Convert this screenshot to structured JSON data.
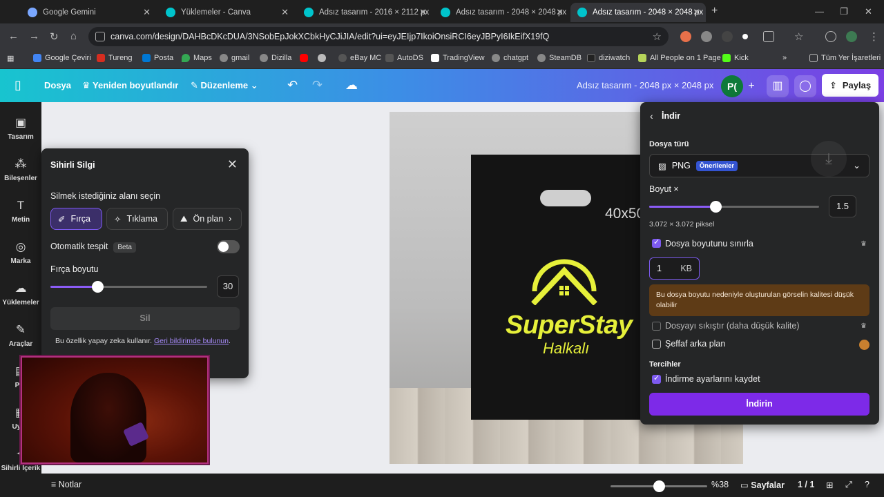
{
  "browser": {
    "tabs": [
      {
        "title": "Google Gemini",
        "color": "#7aa7ff"
      },
      {
        "title": "Yüklemeler - Canva",
        "color": "#00c4cc"
      },
      {
        "title": "Adsız tasarım - 2016 × 2112 px",
        "color": "#00c4cc"
      },
      {
        "title": "Adsız tasarım - 2048 × 2048 px",
        "color": "#00c4cc"
      },
      {
        "title": "Adsız tasarım - 2048 × 2048 px",
        "color": "#00c4cc"
      }
    ],
    "new_tab": "+",
    "url": "canva.com/design/DAHBcDKcDUA/3NSobEpJokXCbkHyCJiJIA/edit?ui=eyJEIjp7IkoiOnsiRCI6eyJBPyI6IkEifX19fQ",
    "bookmarks": [
      {
        "label": "Google Çeviri",
        "color": "#4285f4"
      },
      {
        "label": "Tureng",
        "color": "#d62d20"
      },
      {
        "label": "Posta",
        "color": "#0078d4"
      },
      {
        "label": "Maps",
        "color": "#34a853"
      },
      {
        "label": "gmail",
        "color": "#888888"
      },
      {
        "label": "Dizilla",
        "color": "#888888"
      },
      {
        "label": "eBay MC",
        "color": "#555555"
      },
      {
        "label": "AutoDS",
        "color": "#555555"
      },
      {
        "label": "TradingView",
        "color": "#ffffff"
      },
      {
        "label": "chatgpt",
        "color": "#888888"
      },
      {
        "label": "SteamDB",
        "color": "#888888"
      },
      {
        "label": "diziwatch",
        "color": "#222222"
      },
      {
        "label": "All People on 1 Page",
        "color": "#b6d45a"
      },
      {
        "label": "Kick",
        "color": "#53fc18"
      }
    ],
    "all_bookmarks": "Tüm Yer İşaretleri"
  },
  "canva": {
    "menu": {
      "file": "Dosya",
      "resize": "Yeniden boyutlandır",
      "edit": "Düzenleme"
    },
    "design_title": "Adsız tasarım - 2048 px × 2048 px",
    "avatar": "P(",
    "share": "Paylaş"
  },
  "rail": [
    {
      "label": "Tasarım",
      "icon": "layout-icon"
    },
    {
      "label": "Bileşenler",
      "icon": "elements-icon"
    },
    {
      "label": "Metin",
      "icon": "text-icon"
    },
    {
      "label": "Marka",
      "icon": "brand-icon"
    },
    {
      "label": "Yüklemeler",
      "icon": "upload-icon"
    },
    {
      "label": "Araçlar",
      "icon": "draw-icon"
    },
    {
      "label": "Pro",
      "icon": "projects-icon"
    },
    {
      "label": "Uygu",
      "icon": "apps-icon"
    },
    {
      "label": "Sihirli İçerik",
      "icon": "magic-media-icon"
    }
  ],
  "artboard": {
    "size_text": "40x50",
    "brand": "SuperStay",
    "sub": "Halkalı",
    "logo_color": "#e6f03a"
  },
  "eraser": {
    "title": "Sihirli Silgi",
    "select_area": "Silmek istediğiniz alanı seçin",
    "chips": [
      "Fırça",
      "Tıklama",
      "Ön plan"
    ],
    "auto_detect": "Otomatik tespit",
    "beta": "Beta",
    "brush_size_label": "Fırça boyutu",
    "brush_size": "30",
    "brush_size_value": 30,
    "brush_size_max": 100,
    "erase_button": "Sil",
    "note": "Bu özellik yapay zeka kullanır.",
    "feedback": "Geri bildirimde bulunun"
  },
  "download": {
    "back_title": "İndir",
    "file_type_label": "Dosya türü",
    "file_type": "PNG",
    "recommended": "Önerilenler",
    "size_label": "Boyut ×",
    "size_value": "1.5",
    "size_fraction": 0.39,
    "pixels": "3.072 × 3.072 piksel",
    "limit_size": "Dosya boyutunu sınırla",
    "limit_size_checked": true,
    "kb_value": "1",
    "kb_unit": "KB",
    "warning": "Bu dosya boyutu nedeniyle oluşturulan görselin kalitesi düşük olabilir",
    "compress": "Dosyayı sıkıştır (daha düşük kalite)",
    "transparent": "Şeffaf arka plan",
    "preferences": "Tercihler",
    "save_settings": "İndirme ayarlarını kaydet",
    "save_settings_checked": true,
    "download_button": "İndirin"
  },
  "footer": {
    "notes": "Notlar",
    "zoom": "%38",
    "zoom_fraction": 0.5,
    "pages": "Sayfalar",
    "page_count": "1 / 1"
  },
  "colors": {
    "accent": "#7d2ae8",
    "header_start": "#18c4cf",
    "header_end": "#7b3fe4"
  }
}
